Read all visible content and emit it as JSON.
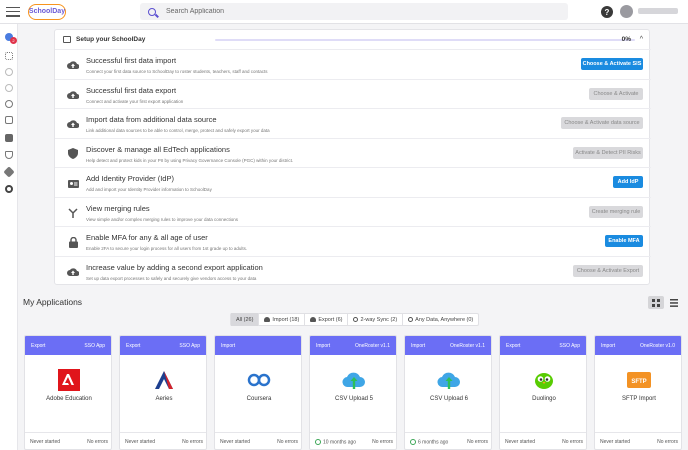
{
  "header": {
    "logo_text": "SchoolDay",
    "search_placeholder": "Search Application",
    "help_label": "?"
  },
  "sidebar": {
    "badge_count": "2"
  },
  "setup": {
    "title": "Setup your SchoolDay",
    "progress_percent": "0%",
    "progress_value": 0,
    "tasks": [
      {
        "title": "Successful first data import",
        "desc": "Connect your first data source to SchoolDay to roster students, teachers, staff and contacts",
        "button": "Choose & Activate SIS",
        "enabled": true
      },
      {
        "title": "Successful first data export",
        "desc": "Connect and activate your first export application",
        "button": "Choose & Activate",
        "enabled": false
      },
      {
        "title": "Import data from additional data source",
        "desc": "Link additional data sources to be able to control, merge, protect and safely export your data",
        "button": "Choose & Activate data source",
        "enabled": false
      },
      {
        "title": "Discover & manage all EdTech applications",
        "desc": "Help detect and protect kids in your PII by using Privacy Governance Console (PGC) within your district.",
        "button": "Activate & Detect PII Risks",
        "enabled": false
      },
      {
        "title": "Add Identity Provider (IdP)",
        "desc": "Add and import your Identity Provider information to SchoolDay",
        "button": "Add IdP",
        "enabled": true
      },
      {
        "title": "View merging rules",
        "desc": "View simple and/or complex merging rules to improve your data connections",
        "button": "Create merging rule",
        "enabled": false
      },
      {
        "title": "Enable MFA for any & all age of user",
        "desc": "Enable 2FA to secure your login process for all users from 1st grade up to adults.",
        "button": "Enable MFA",
        "enabled": true
      },
      {
        "title": "Increase value by adding a second export application",
        "desc": "Set up data export processes to safely and securely give vendors access to your data",
        "button": "Choose & Activate Export",
        "enabled": false
      }
    ]
  },
  "apps": {
    "title": "My Applications",
    "filters": [
      {
        "label": "All (26)",
        "active": true
      },
      {
        "label": "Import (18)",
        "active": false
      },
      {
        "label": "Export (6)",
        "active": false
      },
      {
        "label": "2-way Sync (2)",
        "active": false
      },
      {
        "label": "Any Data, Anywhere (0)",
        "active": false
      }
    ],
    "cards": [
      {
        "type": "Export",
        "tag": "SSO App",
        "name": "Adobe Education",
        "status": "Never started",
        "errors": "No errors",
        "icon": "adobe-icon",
        "ok": false
      },
      {
        "type": "Export",
        "tag": "SSO App",
        "name": "Aeries",
        "status": "Never started",
        "errors": "No errors",
        "icon": "aeries-icon",
        "ok": false
      },
      {
        "type": "Import",
        "tag": "",
        "name": "Coursera",
        "status": "Never started",
        "errors": "No errors",
        "icon": "coursera-icon",
        "ok": false
      },
      {
        "type": "Import",
        "tag": "OneRoster v1.1",
        "name": "CSV Upload 5",
        "status": "10 months ago",
        "errors": "No errors",
        "icon": "cloud-upload-icon",
        "ok": true
      },
      {
        "type": "Import",
        "tag": "OneRoster v1.1",
        "name": "CSV Upload 6",
        "status": "6 months ago",
        "errors": "No errors",
        "icon": "cloud-upload-icon",
        "ok": true
      },
      {
        "type": "Export",
        "tag": "SSO App",
        "name": "Duolingo",
        "status": "Never started",
        "errors": "No errors",
        "icon": "duolingo-icon",
        "ok": false
      },
      {
        "type": "Import",
        "tag": "OneRoster v1.0",
        "name": "SFTP Import",
        "status": "Never started",
        "errors": "No errors",
        "icon": "sftp-icon",
        "ok": false
      }
    ]
  },
  "colors": {
    "accent": "#6b6ef5",
    "primary_button": "#1a8be0",
    "brand_orange": "#f7941d"
  }
}
